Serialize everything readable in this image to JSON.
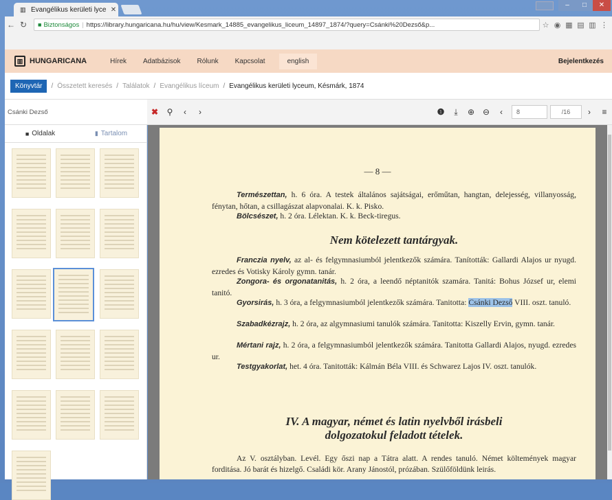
{
  "browser": {
    "tab_title": "Evangélikus kerületi lyce",
    "tab_close": "✕",
    "window_min": "–",
    "window_max": "□",
    "window_close": "✕",
    "secure_label": "Biztonságos",
    "url": "https://library.hungaricana.hu/hu/view/Kesmark_14885_evangelikus_liceum_14897_1874/?query=Csánki%20Dezső&p..."
  },
  "site": {
    "brand": "HUNGARICANA",
    "nav": [
      "Hírek",
      "Adatbázisok",
      "Rólunk",
      "Kapcsolat"
    ],
    "language": "english",
    "login": "Bejelentkezés"
  },
  "breadcrumb": {
    "root": "Könyvtár",
    "items": [
      "Összetett keresés",
      "Találatok",
      "Evangélikus líceum"
    ],
    "current": "Evangélikus kerületi lyceum, Késmárk, 1874"
  },
  "search": {
    "value": "Csánki Dezső",
    "page_current": "8",
    "page_total": "/16"
  },
  "sidebar": {
    "tab_pages": "Oldalak",
    "tab_contents": "Tartalom"
  },
  "document": {
    "page_number": "— 8 —",
    "para1_label": "Természettan,",
    "para1_text": " h. 6 óra. A testek általános sajátságai, erőműtan, hangtan, delejesség, villanyosság, fénytan, hőtan, a csillagászat alapvonalai. K. k. Pisko.",
    "para2_label": "Bölcsészet,",
    "para2_text": " h. 2 óra. Lélektan. K. k. Beck-tiregus.",
    "heading1": "Nem kötelezett tantárgyak.",
    "p3_label": "Franczia nyelv,",
    "p3_text": " az al- és felgymnasiumból jelentkezők számára. Tanították: Gallardi Alajos ur nyugd. ezredes és Votisky Károly gymn. tanár.",
    "p4_label": "Zongora- és orgonatanitás,",
    "p4_text": " h. 2 óra, a leendő néptanitók szamára. Tanitá: Bohus József ur, elemi tanitó.",
    "p5_label": "Gyorsirás,",
    "p5_text_a": " h. 3 óra, a felgymnasiumból jelentkezők számára. Tanitotta:",
    "p5_highlight": "Csánki Dezső",
    "p5_text_b": " VIII. oszt. tanuló.",
    "p6_label": "Szabadkézrajz,",
    "p6_text": " h. 2 óra, az algymnasiumi tanulók számára. Tanitotta: Kiszelly Ervin, gymn. tanár.",
    "p7_label": "Mértani rajz,",
    "p7_text": " h. 2 óra, a felgymnasiumból jelentkezők számára. Tanitotta Gallardi Alajos, nyugd. ezredes ur.",
    "p8_label": "Testgyakorlat,",
    "p8_text": " het. 4 óra. Tanitották: Kálmán Béla VIII. és Schwarez Lajos IV. oszt. tanulók.",
    "heading2_line1": "IV. A magyar, német és latin nyelvből irásbeli",
    "heading2_line2": "dolgozatokul feladott tételek.",
    "p9_text": "Az V. osztályban. Levél. Egy őszi nap a Tátra alatt. A rendes tanuló. Német költemények magyar forditása. Jó barát és hizelgő. Családi kör. Arany Jánostól, prózában. Szülőföldünk leirás."
  },
  "colors": {
    "accent": "#1e66b4",
    "sitebar": "#f6d9c4",
    "paper": "#fbf3d6",
    "highlight": "#9cc2e8"
  }
}
